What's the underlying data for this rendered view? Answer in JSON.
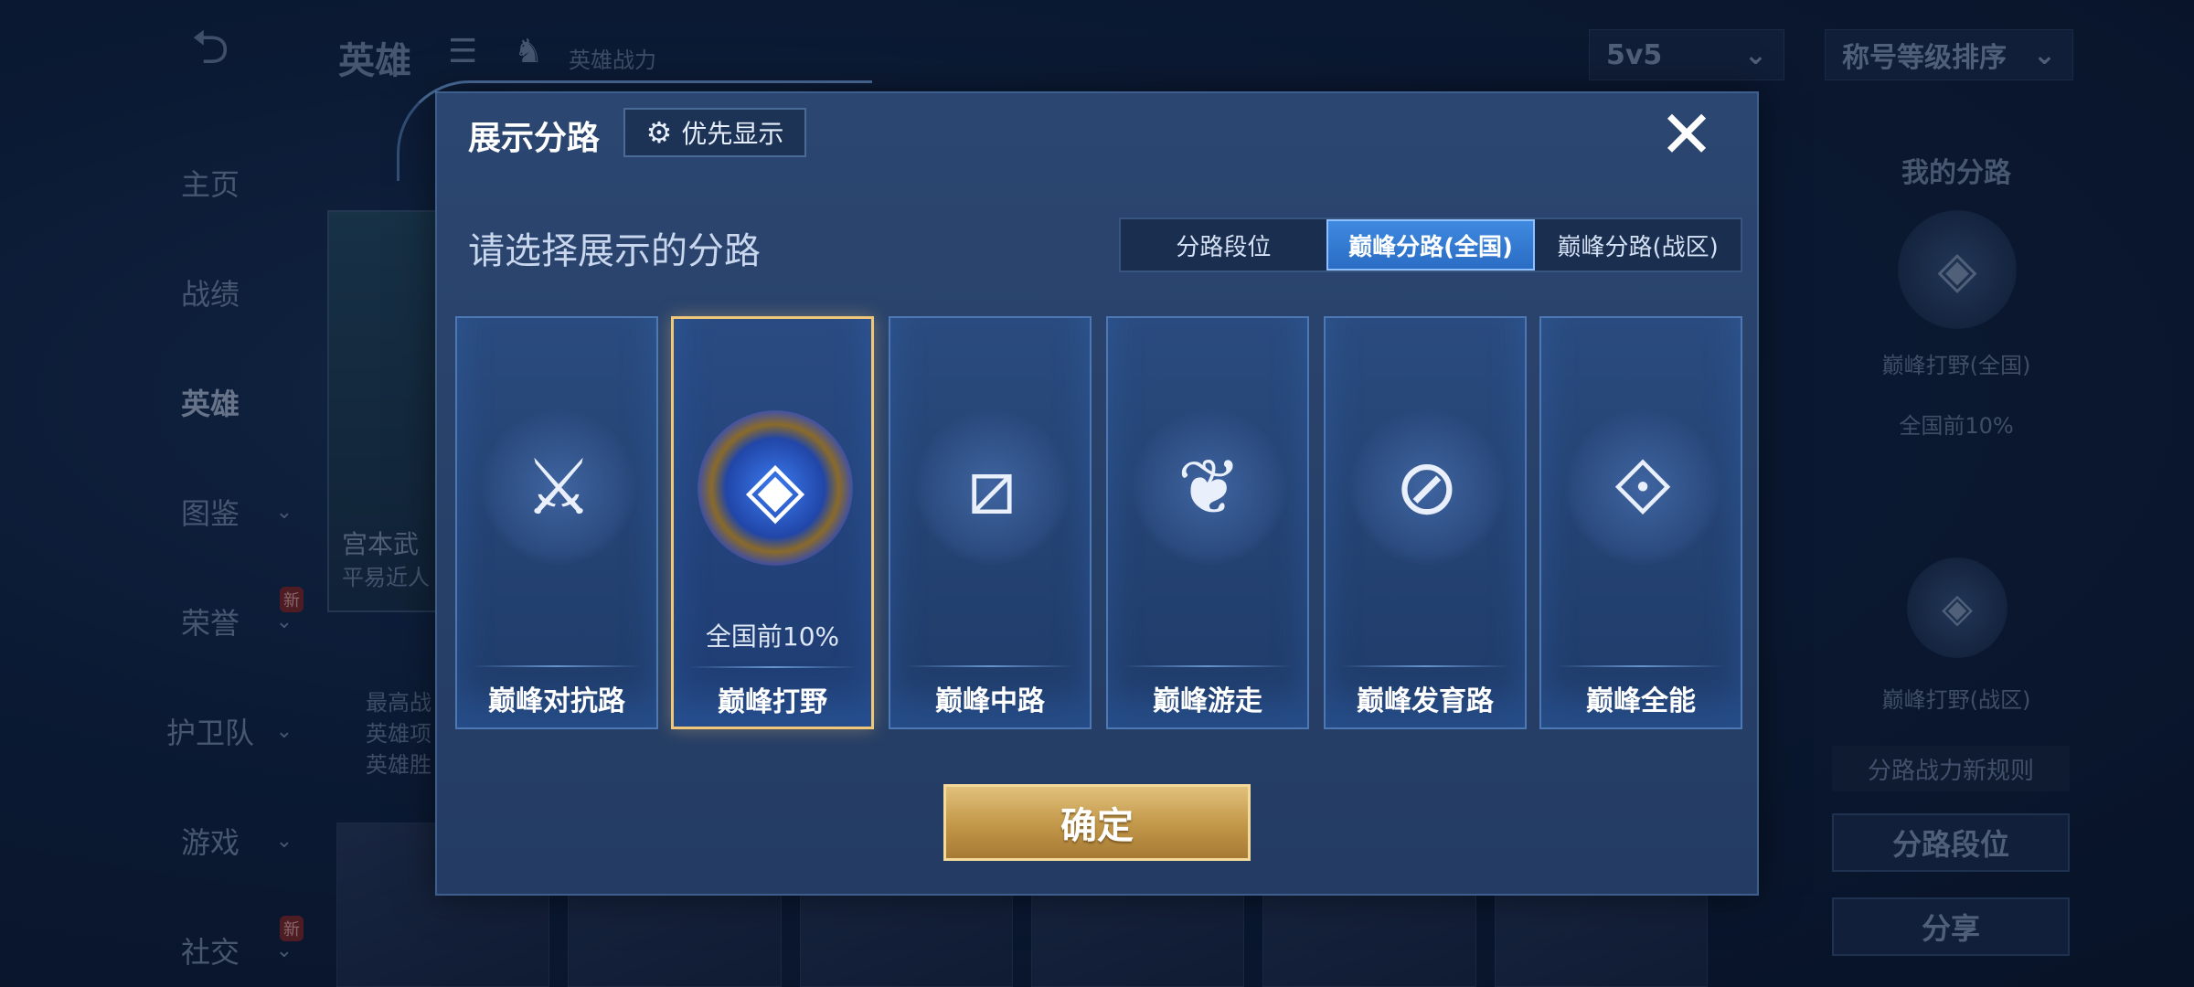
{
  "background": {
    "back_icon": "back-arrow-icon",
    "header_title": "英雄",
    "hero_power_label": "英雄战力",
    "mode_select": "5v5",
    "sort_select": "称号等级排序",
    "nav": [
      {
        "label": "主页",
        "has_chevron": false,
        "new": false
      },
      {
        "label": "战绩",
        "has_chevron": false,
        "new": false
      },
      {
        "label": "英雄",
        "has_chevron": false,
        "new": false,
        "active": true
      },
      {
        "label": "图鉴",
        "has_chevron": true,
        "new": false
      },
      {
        "label": "荣誉",
        "has_chevron": true,
        "new": true
      },
      {
        "label": "护卫队",
        "has_chevron": true,
        "new": false
      },
      {
        "label": "游戏",
        "has_chevron": true,
        "new": false
      },
      {
        "label": "社交",
        "has_chevron": true,
        "new": true
      }
    ],
    "new_badge": "新",
    "hero_name": "宫本武",
    "hero_sub": "平易近人",
    "stats": [
      "最高战",
      "英雄项",
      "英雄胜"
    ],
    "right_panel": {
      "title": "我的分路",
      "route_national": "巅峰打野(全国)",
      "rank_national": "全国前10%",
      "route_zone": "巅峰打野(战区)",
      "rule_text": "分路战力新规则",
      "rank_button": "分路段位",
      "share_button": "分享"
    }
  },
  "modal": {
    "title": "展示分路",
    "priority_button": "优先显示",
    "subtitle": "请选择展示的分路",
    "tabs": [
      {
        "label": "分路段位",
        "active": false
      },
      {
        "label": "巅峰分路(全国)",
        "active": true
      },
      {
        "label": "巅峰分路(战区)",
        "active": false
      }
    ],
    "cards": [
      {
        "label": "巅峰对抗路",
        "rank": "",
        "selected": false,
        "icon": "clash-lane-icon"
      },
      {
        "label": "巅峰打野",
        "rank": "全国前10%",
        "selected": true,
        "icon": "jungle-dragon-emblem-icon"
      },
      {
        "label": "巅峰中路",
        "rank": "",
        "selected": false,
        "icon": "mid-lane-icon"
      },
      {
        "label": "巅峰游走",
        "rank": "",
        "selected": false,
        "icon": "roam-wings-icon"
      },
      {
        "label": "巅峰发育路",
        "rank": "",
        "selected": false,
        "icon": "farm-lane-icon"
      },
      {
        "label": "巅峰全能",
        "rank": "",
        "selected": false,
        "icon": "all-round-icon"
      }
    ],
    "confirm_button": "确定"
  },
  "colors": {
    "accent_gold": "#f0c678",
    "tab_active": "#3f8ae0",
    "modal_bg": "#2b4670"
  }
}
